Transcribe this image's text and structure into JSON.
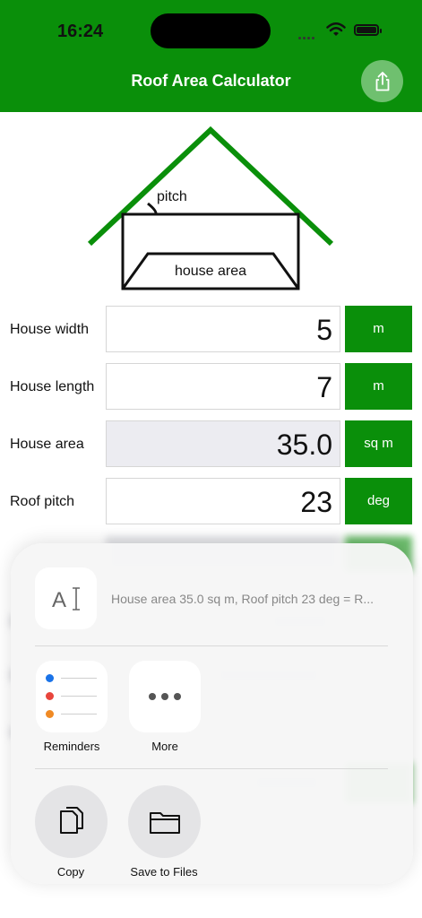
{
  "status_bar": {
    "time": "16:24"
  },
  "nav": {
    "title": "Roof Area Calculator"
  },
  "diagram": {
    "pitch_label": "pitch",
    "house_area_label": "house area"
  },
  "rows": [
    {
      "label": "House width",
      "value": "5",
      "unit": "m"
    },
    {
      "label": "House length",
      "value": "7",
      "unit": "m"
    },
    {
      "label": "House area",
      "value": "35.0",
      "unit": "sq m"
    },
    {
      "label": "Roof pitch",
      "value": "23",
      "unit": "deg"
    }
  ],
  "share_sheet": {
    "preview_text": "House area 35.0 sq m, Roof pitch 23 deg = R...",
    "apps": [
      {
        "label": "Reminders",
        "icon": "reminders-icon"
      },
      {
        "label": "More",
        "icon": "more-icon"
      }
    ],
    "actions": [
      {
        "label": "Copy",
        "icon": "copy-icon"
      },
      {
        "label": "Save to Files",
        "icon": "folder-icon"
      }
    ]
  },
  "colors": {
    "brand_green": "#0a8f0a",
    "share_button": "#6fc06f"
  }
}
